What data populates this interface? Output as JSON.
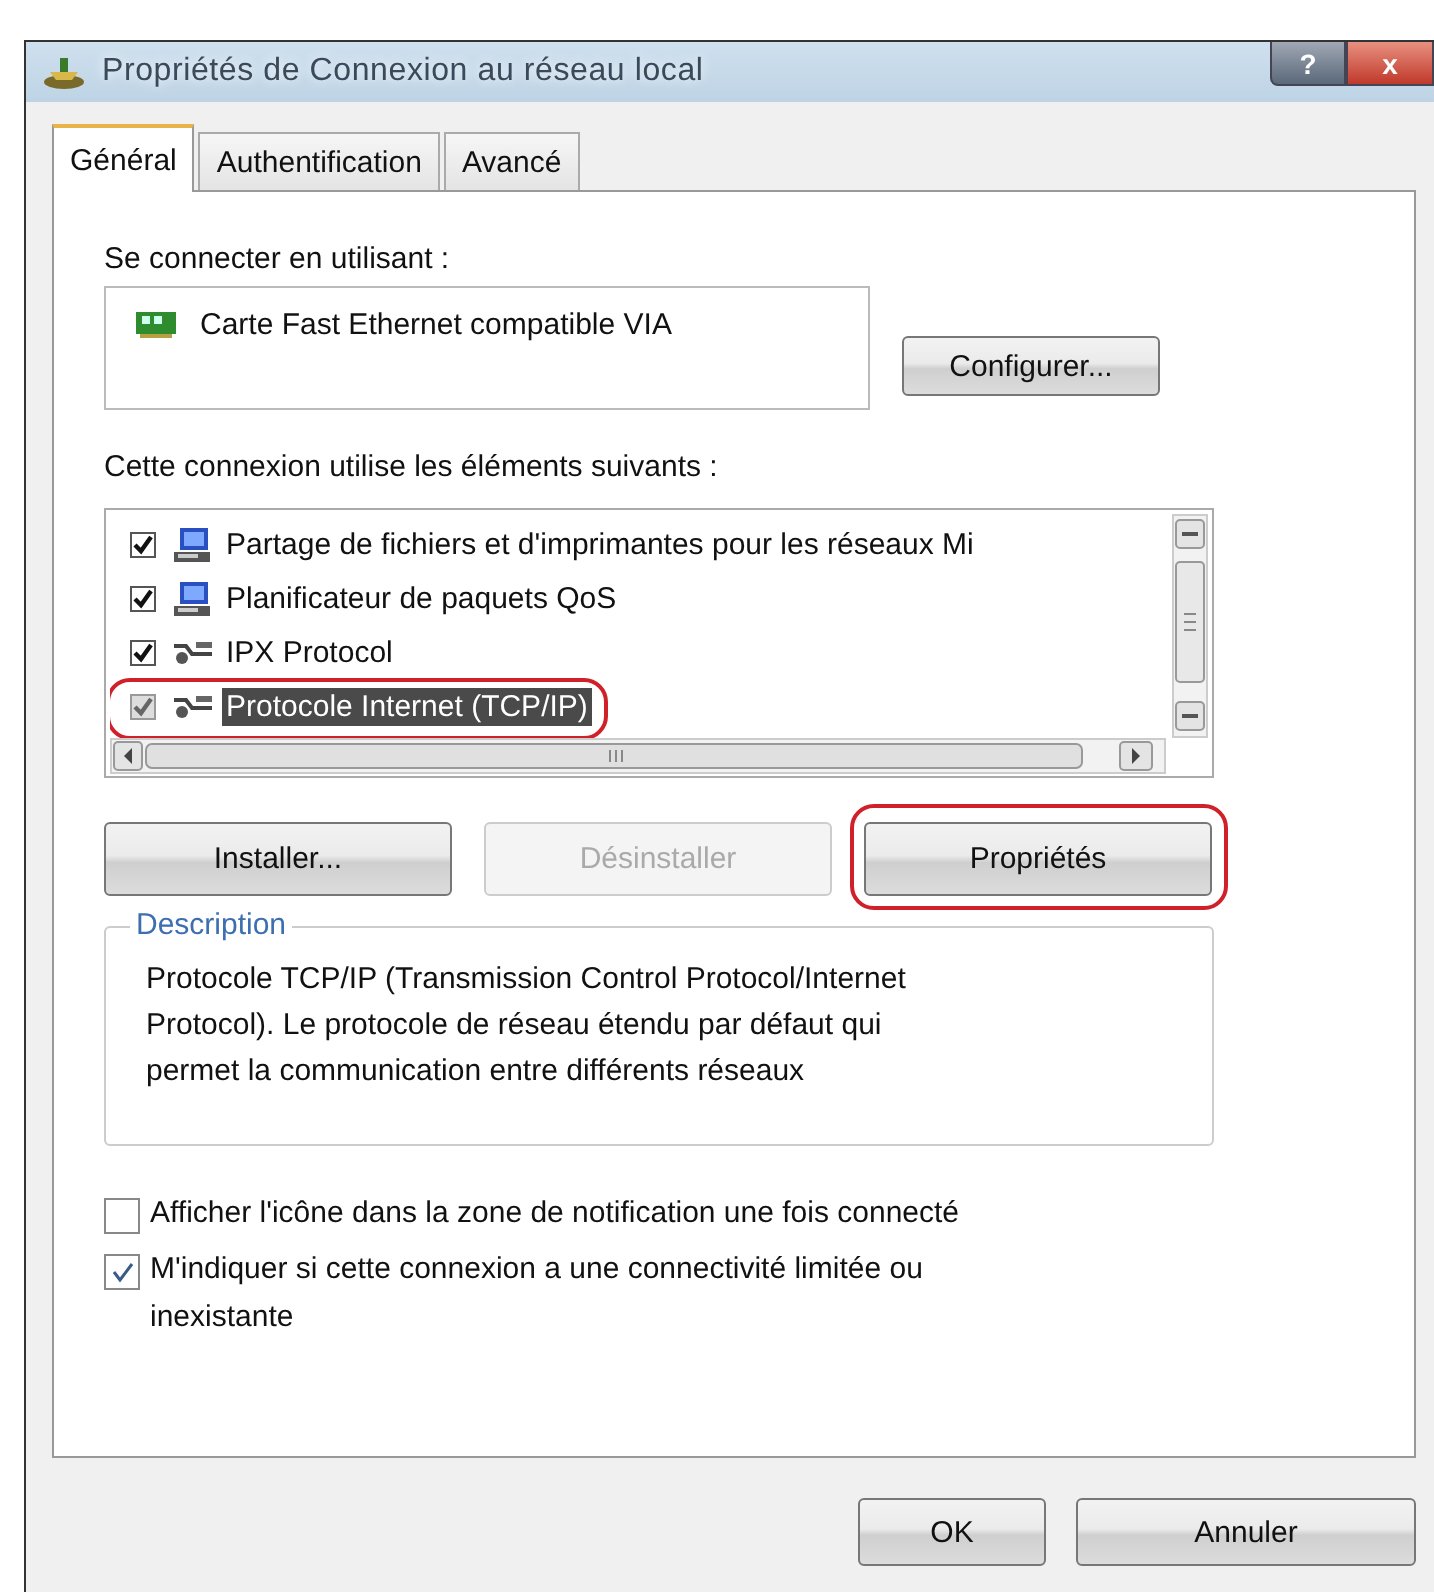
{
  "window": {
    "title": "Propriétés de Connexion au réseau local",
    "help_button": "?",
    "close_button": "x"
  },
  "tabs": [
    {
      "label": "Général",
      "selected": true
    },
    {
      "label": "Authentification",
      "selected": false
    },
    {
      "label": "Avancé",
      "selected": false
    }
  ],
  "connect_using": {
    "label": "Se connecter en utilisant :",
    "adapter": "Carte Fast Ethernet compatible VIA",
    "button": "Configurer..."
  },
  "components": {
    "label": "Cette connexion utilise les éléments suivants :",
    "items": [
      {
        "name": "Partage de fichiers et d'imprimantes pour les réseaux Mi",
        "kind": "service",
        "checked": true,
        "selected": false,
        "highlighted": false
      },
      {
        "name": "Planificateur de paquets QoS",
        "kind": "service",
        "checked": true,
        "selected": false,
        "highlighted": false
      },
      {
        "name": "IPX Protocol",
        "kind": "protocol",
        "checked": true,
        "selected": false,
        "highlighted": false
      },
      {
        "name": "Protocole Internet (TCP/IP)",
        "kind": "protocol",
        "checked": true,
        "selected": true,
        "highlighted": true
      }
    ]
  },
  "buttons": [
    {
      "label": "Installer...",
      "disabled": false,
      "highlighted": false
    },
    {
      "label": "Désinstaller",
      "disabled": true,
      "highlighted": false
    },
    {
      "label": "Propriétés",
      "disabled": false,
      "highlighted": true
    }
  ],
  "description": {
    "title": "Description",
    "text": "Protocole TCP/IP (Transmission Control Protocol/Internet Protocol). Le protocole de réseau étendu par défaut qui permet la communication entre différents réseaux"
  },
  "options": [
    {
      "label": "Afficher l'icône dans la zone de notification une fois connecté",
      "checked": false
    },
    {
      "label": "M'indiquer si cette connexion a une connectivité limitée ou inexistante",
      "checked": true
    }
  ],
  "dialog_buttons": [
    "OK",
    "Annuler"
  ]
}
